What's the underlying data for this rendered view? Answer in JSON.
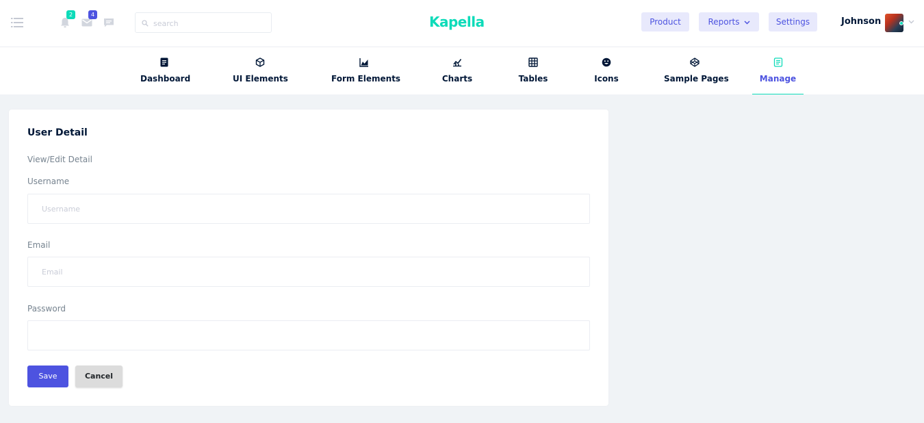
{
  "topbar": {
    "notifications_count": "2",
    "messages_count": "4",
    "search_placeholder": "search",
    "brand": "Kapella",
    "buttons": {
      "product": "Product",
      "reports": "Reports",
      "settings": "Settings"
    },
    "user_name": "Johnson"
  },
  "nav": {
    "items": [
      {
        "label": "Dashboard",
        "icon": "file-text-icon"
      },
      {
        "label": "UI Elements",
        "icon": "cube-icon"
      },
      {
        "label": "Form Elements",
        "icon": "area-chart-icon"
      },
      {
        "label": "Charts",
        "icon": "chart-icon"
      },
      {
        "label": "Tables",
        "icon": "grid-icon"
      },
      {
        "label": "Icons",
        "icon": "emoji-icon"
      },
      {
        "label": "Sample Pages",
        "icon": "codepen-icon"
      },
      {
        "label": "Manage",
        "icon": "document-icon"
      }
    ],
    "active": "Manage"
  },
  "form": {
    "title": "User Detail",
    "description": "View/Edit Detail",
    "username_label": "Username",
    "username_placeholder": "Username",
    "email_label": "Email",
    "email_placeholder": "Email",
    "password_label": "Password",
    "password_placeholder": "",
    "save_label": "Save",
    "cancel_label": "Cancel"
  },
  "colors": {
    "brand": "#0ddbb9",
    "accent": "#4d53e0",
    "pill_bg": "#e8e9fc",
    "page_bg": "#f0f3f6",
    "cancel_bg": "#dcdcdc"
  }
}
